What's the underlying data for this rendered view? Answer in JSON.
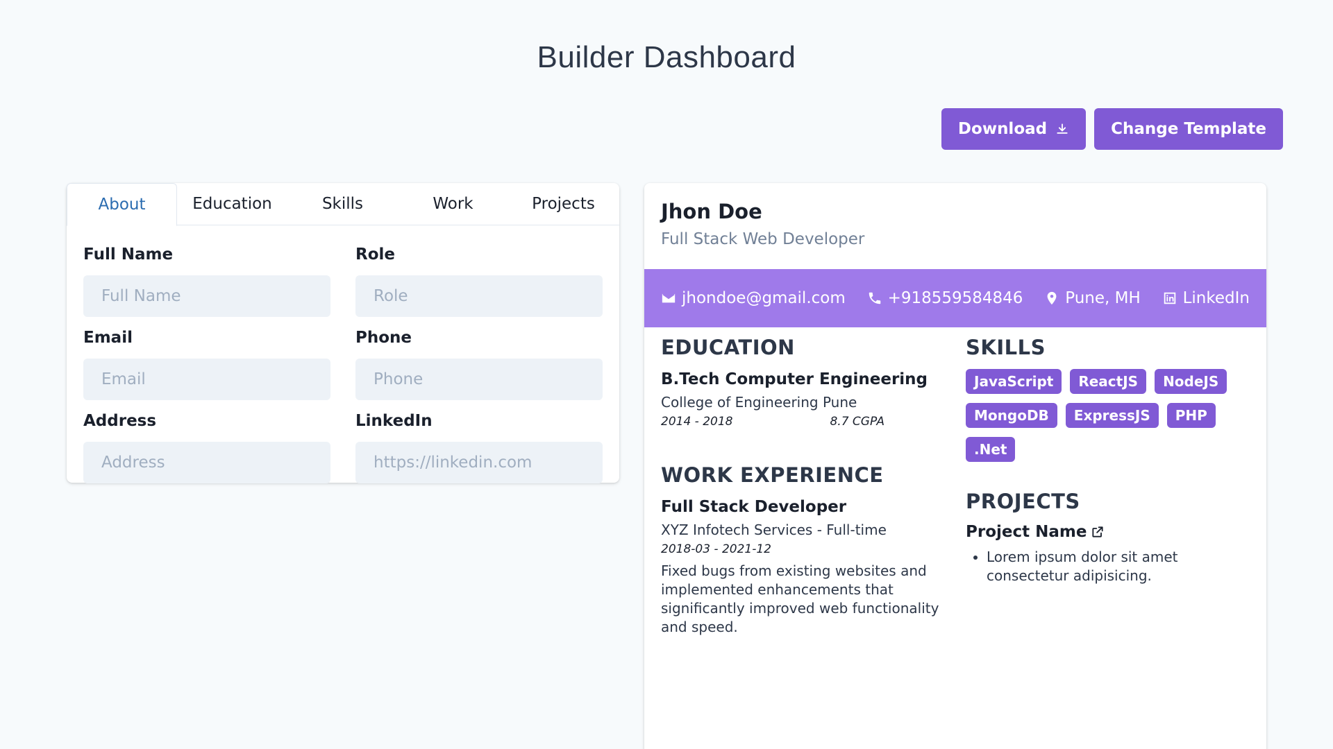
{
  "header": {
    "title": "Builder Dashboard"
  },
  "actions": {
    "download_label": "Download",
    "change_template_label": "Change Template"
  },
  "tabs": [
    "About",
    "Education",
    "Skills",
    "Work",
    "Projects"
  ],
  "active_tab": "About",
  "form": {
    "fields": [
      {
        "label": "Full Name",
        "placeholder": "Full Name",
        "value": ""
      },
      {
        "label": "Role",
        "placeholder": "Role",
        "value": ""
      },
      {
        "label": "Email",
        "placeholder": "Email",
        "value": ""
      },
      {
        "label": "Phone",
        "placeholder": "Phone",
        "value": ""
      },
      {
        "label": "Address",
        "placeholder": "Address",
        "value": ""
      },
      {
        "label": "LinkedIn",
        "placeholder": "https://linkedin.com",
        "value": ""
      }
    ]
  },
  "resume": {
    "name": "Jhon Doe",
    "role": "Full Stack Web Developer",
    "contact": {
      "email": "jhondoe@gmail.com",
      "phone": "+918559584846",
      "address": "Pune, MH",
      "linkedin": "LinkedIn"
    },
    "education": {
      "title": "EDUCATION",
      "degree": "B.Tech Computer Engineering",
      "school": "College of Engineering Pune",
      "years": "2014 - 2018",
      "grade": "8.7 CGPA"
    },
    "work": {
      "title": "WORK EXPERIENCE",
      "position": "Full Stack Developer",
      "company": "XYZ Infotech Services - Full-time",
      "dates": "2018-03 - 2021-12",
      "description": "Fixed bugs from existing websites and implemented enhancements that significantly improved web functionality and speed."
    },
    "skills": {
      "title": "SKILLS",
      "items": [
        "JavaScript",
        "ReactJS",
        "NodeJS",
        "MongoDB",
        "ExpressJS",
        "PHP",
        ".Net"
      ]
    },
    "projects": {
      "title": "PROJECTS",
      "name": "Project Name",
      "points": [
        "Lorem ipsum dolor sit amet consectetur adipisicing."
      ]
    }
  },
  "colors": {
    "accent": "#805ad5",
    "contact_bar": "#9f7aea",
    "active_tab": "#2b6cb0"
  }
}
